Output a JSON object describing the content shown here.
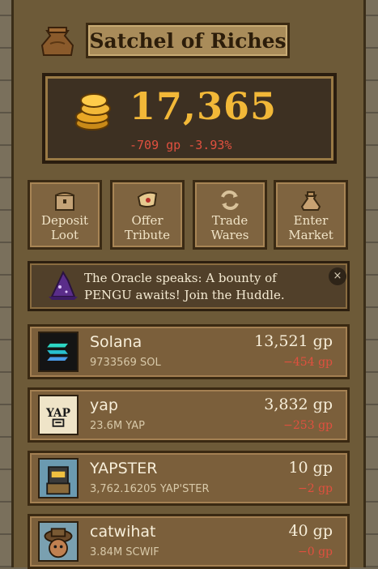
{
  "header": {
    "title": "Satchel of Riches",
    "icon": "money-bag-icon"
  },
  "balance": {
    "amount": "17,365",
    "change": "-709 gp -3.93%",
    "icon": "gold-coins-icon"
  },
  "actions": [
    {
      "label": "Deposit\nLoot",
      "icon": "satchel-icon"
    },
    {
      "label": "Offer\nTribute",
      "icon": "scroll-icon"
    },
    {
      "label": "Trade\nWares",
      "icon": "exchange-icon"
    },
    {
      "label": "Enter\nMarket",
      "icon": "sack-icon"
    }
  ],
  "oracle": {
    "text": "The Oracle speaks: A bounty of PENGU awaits! Join the Huddle.",
    "close": "×",
    "icon": "wizard-hat-icon"
  },
  "tokens": [
    {
      "name": "Solana",
      "amount": "9733569 SOL",
      "value": "13,521 gp",
      "change": "−454 gp",
      "icon": "solana-icon"
    },
    {
      "name": "yap",
      "amount": "23.6M YAP",
      "value": "3,832 gp",
      "change": "−253 gp",
      "icon": "yap-icon",
      "icon_text": "YAP"
    },
    {
      "name": "YAPSTER",
      "amount": "3,762.16205 YAP'STER",
      "value": "10 gp",
      "change": "−2 gp",
      "icon": "robot-icon"
    },
    {
      "name": "catwihat",
      "amount": "3.84M SCWIF",
      "value": "40 gp",
      "change": "−0 gp",
      "icon": "cat-hat-icon"
    }
  ],
  "colors": {
    "gold": "#f2b838",
    "negative": "#e0503f",
    "parchment": "#f4ead2"
  }
}
